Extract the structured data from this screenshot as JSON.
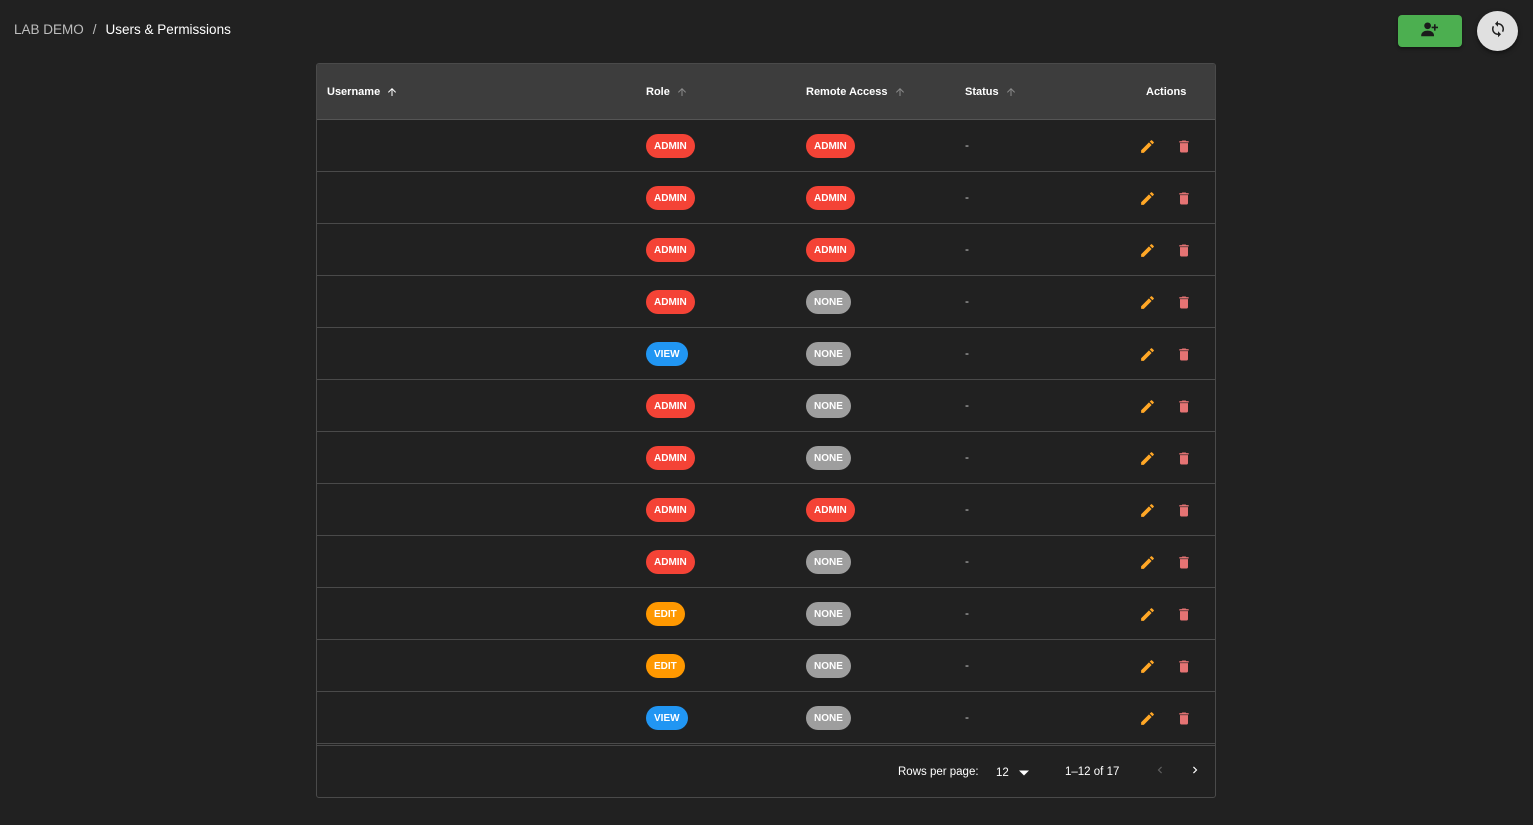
{
  "breadcrumb": {
    "root": "LAB DEMO",
    "separator": "/",
    "current": "Users & Permissions"
  },
  "toolbar": {
    "add_user_icon": "person-add-icon",
    "refresh_icon": "refresh-icon"
  },
  "colors": {
    "admin": "#f44336",
    "view": "#2196f3",
    "edit": "#ff9800",
    "none": "#9e9e9e",
    "edit_action": "#ffa726",
    "delete_action": "#e57373",
    "add_button": "#4caf50"
  },
  "table": {
    "headers": {
      "username": "Username",
      "role": "Role",
      "remote_access": "Remote Access",
      "status": "Status",
      "actions": "Actions"
    },
    "rows": [
      {
        "username": "",
        "role": "ADMIN",
        "remote_access": "ADMIN",
        "status": "-"
      },
      {
        "username": "",
        "role": "ADMIN",
        "remote_access": "ADMIN",
        "status": "-"
      },
      {
        "username": "",
        "role": "ADMIN",
        "remote_access": "ADMIN",
        "status": "-"
      },
      {
        "username": "",
        "role": "ADMIN",
        "remote_access": "NONE",
        "status": "-"
      },
      {
        "username": "",
        "role": "VIEW",
        "remote_access": "NONE",
        "status": "-"
      },
      {
        "username": "",
        "role": "ADMIN",
        "remote_access": "NONE",
        "status": "-"
      },
      {
        "username": "",
        "role": "ADMIN",
        "remote_access": "NONE",
        "status": "-"
      },
      {
        "username": "",
        "role": "ADMIN",
        "remote_access": "ADMIN",
        "status": "-"
      },
      {
        "username": "",
        "role": "ADMIN",
        "remote_access": "NONE",
        "status": "-"
      },
      {
        "username": "",
        "role": "EDIT",
        "remote_access": "NONE",
        "status": "-"
      },
      {
        "username": "",
        "role": "EDIT",
        "remote_access": "NONE",
        "status": "-"
      },
      {
        "username": "",
        "role": "VIEW",
        "remote_access": "NONE",
        "status": "-"
      }
    ]
  },
  "pagination": {
    "rows_per_page_label": "Rows per page:",
    "rows_per_page": "12",
    "range": "1–12 of 17"
  }
}
